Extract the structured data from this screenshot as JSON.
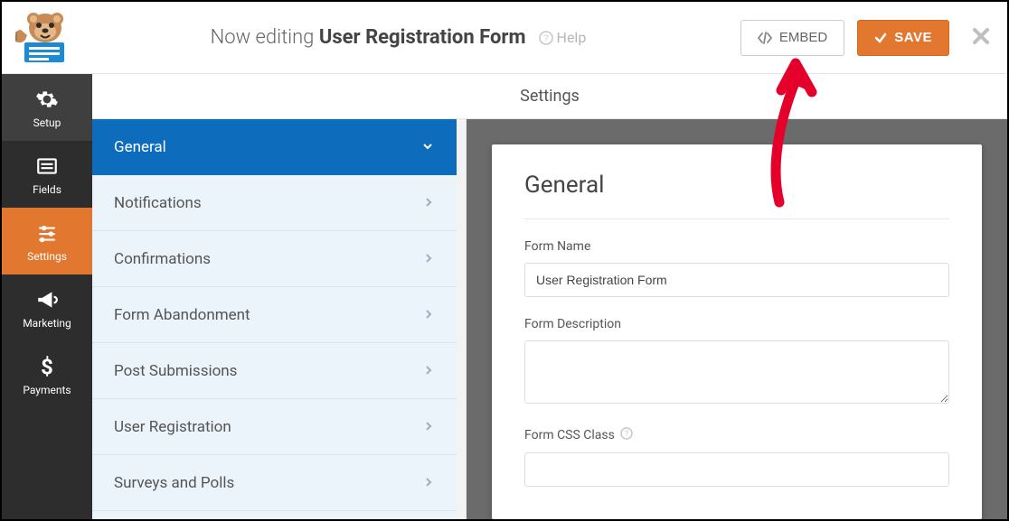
{
  "header": {
    "editing_prefix": "Now editing",
    "form_title": "User Registration Form",
    "help_label": "Help",
    "embed_label": "EMBED",
    "save_label": "SAVE"
  },
  "leftnav": {
    "items": [
      {
        "label": "Setup"
      },
      {
        "label": "Fields"
      },
      {
        "label": "Settings"
      },
      {
        "label": "Marketing"
      },
      {
        "label": "Payments"
      }
    ]
  },
  "subheader": {
    "title": "Settings"
  },
  "settings_panel": {
    "items": [
      {
        "label": "General",
        "expanded": true
      },
      {
        "label": "Notifications"
      },
      {
        "label": "Confirmations"
      },
      {
        "label": "Form Abandonment"
      },
      {
        "label": "Post Submissions"
      },
      {
        "label": "User Registration"
      },
      {
        "label": "Surveys and Polls"
      }
    ]
  },
  "form": {
    "section_title": "General",
    "name_label": "Form Name",
    "name_value": "User Registration Form",
    "description_label": "Form Description",
    "description_value": "",
    "css_label": "Form CSS Class",
    "css_value": ""
  },
  "colors": {
    "accent": "#e27730",
    "blue": "#0e6cbd",
    "sidebar": "#2d2d2d"
  }
}
